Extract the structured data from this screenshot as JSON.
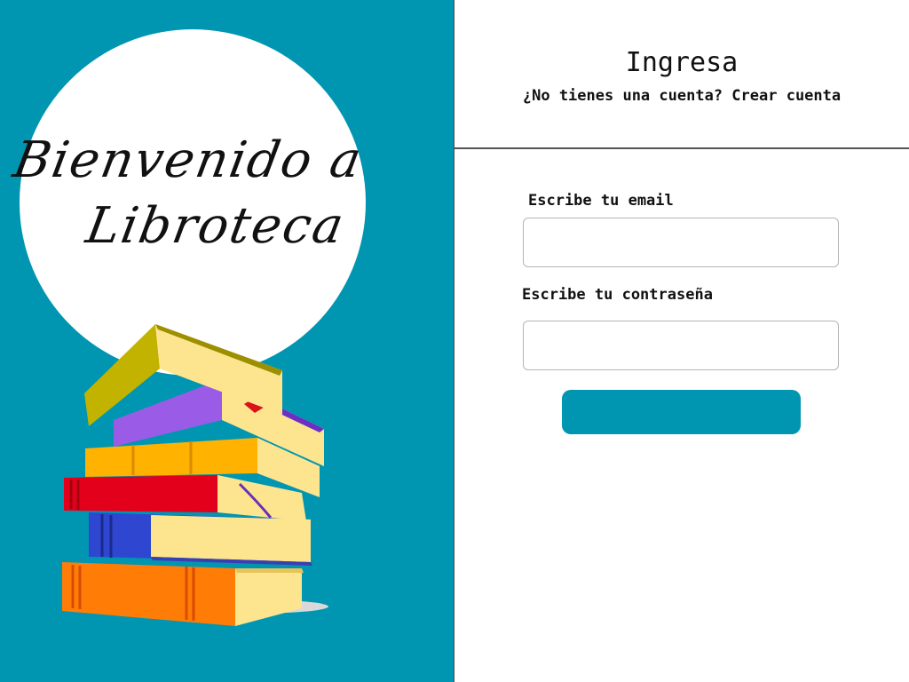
{
  "brand": {
    "welcome_line_1": "Bienvenido a",
    "welcome_line_2": "Libroteca",
    "colors": {
      "accent": "#0096b1",
      "background": "#ffffff"
    }
  },
  "login": {
    "title": "Ingresa",
    "signup_prompt": "¿No tienes una cuenta?",
    "signup_link": "Crear cuenta",
    "email_label": "Escribe tu email",
    "email_value": "",
    "password_label": "Escribe tu contraseña",
    "password_value": "",
    "submit_label": ""
  },
  "illustration": {
    "icon": "stack-of-books-icon"
  }
}
